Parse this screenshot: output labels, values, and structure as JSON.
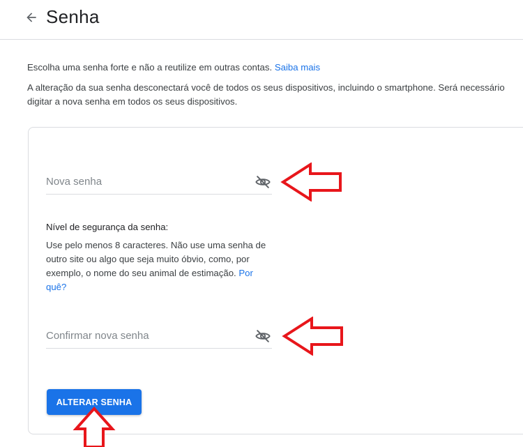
{
  "header": {
    "back_icon": "arrow-left-icon",
    "title": "Senha"
  },
  "intro": {
    "line1": "Escolha uma senha forte e não a reutilize em outras contas.",
    "line1_link": "Saiba mais",
    "line2": "A alteração da sua senha desconectará você de todos os seus dispositivos, incluindo o smartphone. Será necessário digitar a nova senha em todos os seus dispositivos."
  },
  "form": {
    "new_password": {
      "placeholder": "Nova senha",
      "value": "",
      "toggle_icon": "eye-off-icon"
    },
    "strength": {
      "title": "Nível de segurança da senha:",
      "description": "Use pelo menos 8 caracteres. Não use uma senha de outro site ou algo que seja muito óbvio, como, por exemplo, o nome do seu animal de estimação.",
      "link": "Por quê?"
    },
    "confirm_password": {
      "placeholder": "Confirmar nova senha",
      "value": "",
      "toggle_icon": "eye-off-icon"
    },
    "submit_label": "ALTERAR SENHA"
  },
  "annotations": {
    "arrow_color": "#e8161b"
  },
  "colors": {
    "accent": "#1a73e8",
    "divider": "#dadce0",
    "text_primary": "#202124",
    "text_secondary": "#3c4043",
    "placeholder": "#80868b"
  }
}
